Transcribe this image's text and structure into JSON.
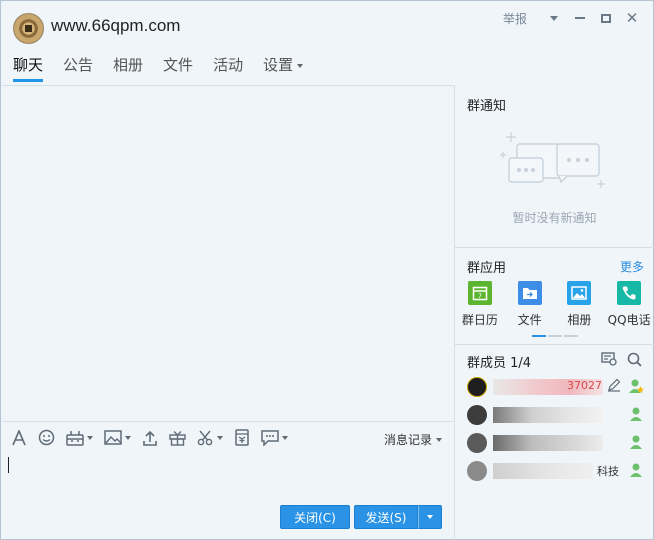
{
  "window": {
    "title": "www.66qpm.com",
    "report_label": "举报"
  },
  "tabs": [
    {
      "label": "聊天",
      "active": true
    },
    {
      "label": "公告"
    },
    {
      "label": "相册"
    },
    {
      "label": "文件"
    },
    {
      "label": "活动"
    },
    {
      "label": "设置"
    }
  ],
  "toolbar": {
    "history_label": "消息记录"
  },
  "buttons": {
    "close_label": "关闭(C)",
    "send_label": "发送(S)"
  },
  "notice": {
    "title": "群通知",
    "empty_text": "暂时没有新通知"
  },
  "apps": {
    "title": "群应用",
    "more_label": "更多",
    "items": [
      {
        "label": "群日历",
        "icon": "calendar-icon",
        "color": "#5cb531"
      },
      {
        "label": "文件",
        "icon": "folder-icon",
        "color": "#3e8ee8"
      },
      {
        "label": "相册",
        "icon": "image-icon",
        "color": "#29a3e8"
      },
      {
        "label": "QQ电话",
        "icon": "phone-icon",
        "color": "#16b9a6"
      }
    ]
  },
  "members": {
    "title": "群成员 1/4",
    "rows": [
      {
        "suffix": "37027",
        "suffix_color": "#d94a4a",
        "role": "owner"
      },
      {
        "suffix": "",
        "role": "member"
      },
      {
        "suffix": "",
        "role": "member"
      },
      {
        "suffix": "科技",
        "role": "member"
      }
    ]
  },
  "colors": {
    "accent": "#2a93e6",
    "background": "#f0f5fa"
  }
}
